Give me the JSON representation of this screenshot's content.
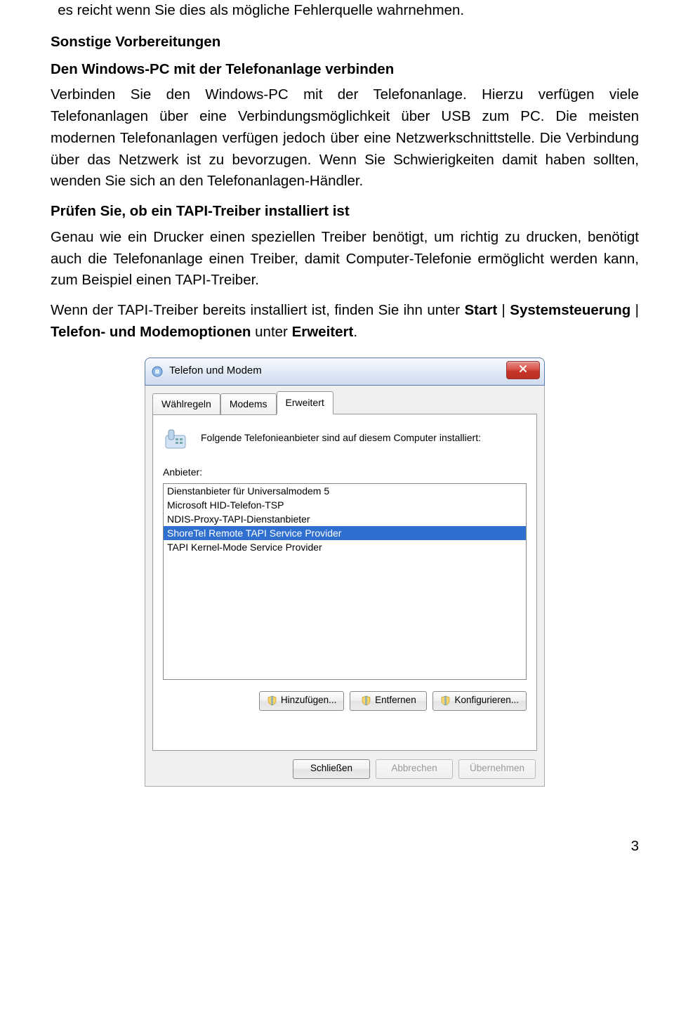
{
  "document": {
    "para1": "es reicht wenn Sie dies als mögliche Fehlerquelle wahrnehmen.",
    "heading1": "Sonstige Vorbereitungen",
    "subheading1": "Den Windows-PC mit der Telefonanlage verbinden",
    "para2": "Verbinden Sie den Windows-PC mit der Telefonanlage. Hierzu verfügen viele Telefonanlagen über eine Verbindungsmöglichkeit über USB zum PC. Die meisten modernen Telefonanlagen verfügen jedoch über eine Netzwerkschnittstelle. Die Verbindung über das Netzwerk ist zu bevorzugen. Wenn Sie Schwierigkeiten damit haben sollten, wenden Sie sich an den Telefonanlagen-Händler.",
    "subheading2": "Prüfen Sie, ob ein TAPI-Treiber installiert ist",
    "para3": "Genau wie ein Drucker einen speziellen Treiber benötigt, um richtig zu drucken, benötigt auch die Telefonanlage einen Treiber, damit Computer-Telefonie ermöglicht werden kann, zum Beispiel einen TAPI-Treiber.",
    "para4_pre": "Wenn der TAPI-Treiber bereits installiert ist, finden Sie ihn unter ",
    "para4_b1": "Start",
    "para4_mid1": " | ",
    "para4_b2": "Systemsteuerung",
    "para4_mid2": " | ",
    "para4_b3": "Telefon- und Modemoptionen",
    "para4_mid3": " unter ",
    "para4_b4": "Erweitert",
    "para4_end": ".",
    "page_number": "3"
  },
  "dialog": {
    "title": "Telefon und Modem",
    "tabs": [
      "Wählregeln",
      "Modems",
      "Erweitert"
    ],
    "intro": "Folgende Telefonieanbieter sind auf diesem Computer installiert:",
    "label": "Anbieter:",
    "providers": [
      {
        "label": "Dienstanbieter für Universalmodem 5",
        "selected": false
      },
      {
        "label": "Microsoft HID-Telefon-TSP",
        "selected": false
      },
      {
        "label": "NDIS-Proxy-TAPI-Dienstanbieter",
        "selected": false
      },
      {
        "label": "ShoreTel Remote TAPI Service Provider",
        "selected": true
      },
      {
        "label": "TAPI Kernel-Mode Service Provider",
        "selected": false
      }
    ],
    "buttons": {
      "add": "Hinzufügen...",
      "remove": "Entfernen",
      "configure": "Konfigurieren...",
      "close": "Schließen",
      "cancel": "Abbrechen",
      "apply": "Übernehmen"
    }
  }
}
